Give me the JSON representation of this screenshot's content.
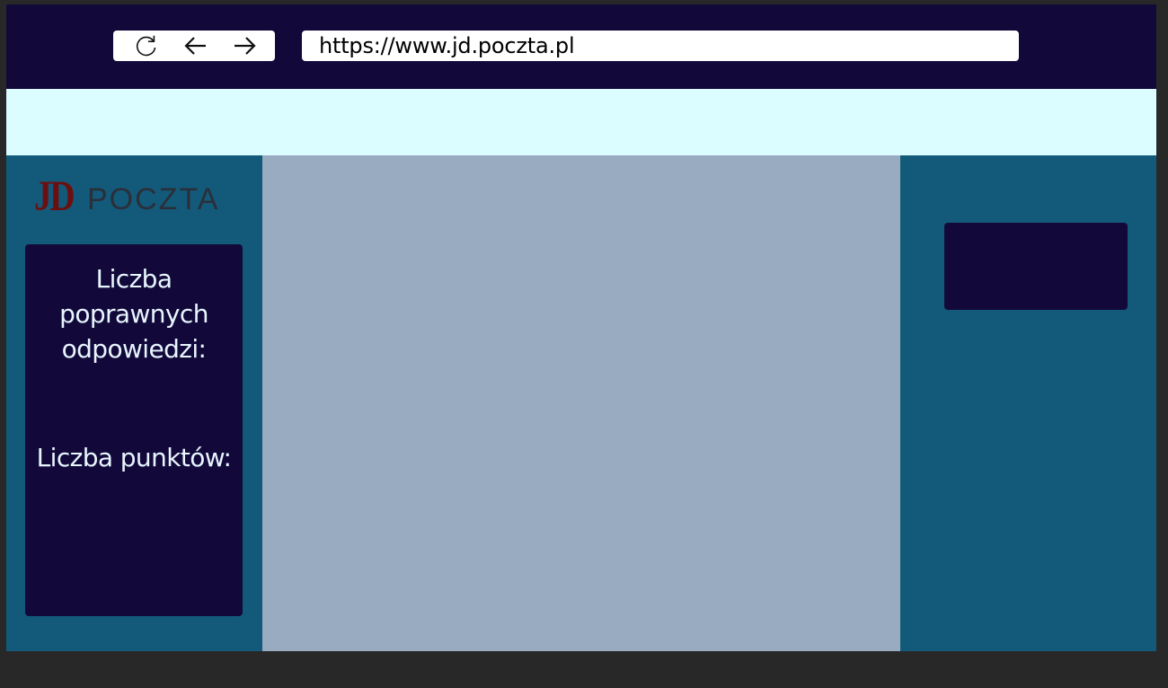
{
  "browser": {
    "url": "https://www.jd.poczta.pl",
    "icons": [
      "refresh-icon",
      "arrow-left-icon",
      "arrow-right-icon"
    ]
  },
  "logo": {
    "mark": "JD",
    "word": "POCZTA",
    "mark_color": "#6b1010",
    "word_color": "#2a2f3a"
  },
  "stats": {
    "correct_answers_label": "Liczba poprawnych odpowiedzi:",
    "points_label": "Liczba punktów:"
  },
  "colors": {
    "page_background": "#282828",
    "top_bar": "#12093a",
    "banner": "#dcfdff",
    "side_panels": "#135a7a",
    "center_area": "#99abc1",
    "dark_box": "#12093a"
  }
}
